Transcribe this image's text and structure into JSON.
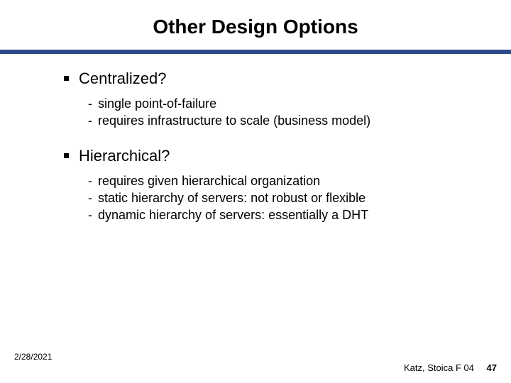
{
  "title": "Other Design Options",
  "sections": [
    {
      "heading": "Centralized?",
      "items": [
        "single point-of-failure",
        "requires infrastructure to scale (business model)"
      ]
    },
    {
      "heading": "Hierarchical?",
      "items": [
        "requires given hierarchical organization",
        "static hierarchy of servers: not robust or flexible",
        "dynamic hierarchy of servers: essentially a DHT"
      ]
    }
  ],
  "footer": {
    "date": "2/28/2021",
    "credit": "Katz, Stoica F 04",
    "page": "47"
  },
  "colors": {
    "rule": "#2d4a8a"
  }
}
